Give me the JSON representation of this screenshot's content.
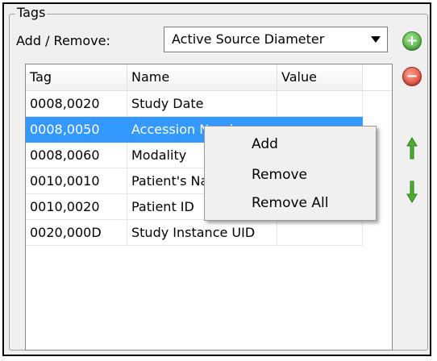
{
  "group": {
    "title": "Tags"
  },
  "add_remove": {
    "label": "Add / Remove:",
    "selected": "Active Source Diameter"
  },
  "list": {
    "columns": [
      "Tag",
      "Name",
      "Value"
    ],
    "rows": [
      {
        "tag": "0008,0020",
        "name": "Study Date",
        "value": ""
      },
      {
        "tag": "0008,0050",
        "name": "Accession Number",
        "value": "",
        "selected": true
      },
      {
        "tag": "0008,0060",
        "name": "Modality",
        "value": ""
      },
      {
        "tag": "0010,0010",
        "name": "Patient's Name",
        "value": ""
      },
      {
        "tag": "0010,0020",
        "name": "Patient ID",
        "value": ""
      },
      {
        "tag": "0020,000D",
        "name": "Study Instance UID",
        "value": ""
      }
    ]
  },
  "context_menu": {
    "items": [
      "Add",
      "Remove",
      "Remove All"
    ]
  },
  "icons": {
    "add": "green-plus-circle-icon",
    "remove": "red-minus-circle-icon",
    "up": "green-up-arrow-icon",
    "down": "green-down-arrow-icon"
  },
  "colors": {
    "selection": "#3399ff",
    "add": "#3fa332",
    "remove": "#d23a2a",
    "arrow": "#4caf2f"
  }
}
